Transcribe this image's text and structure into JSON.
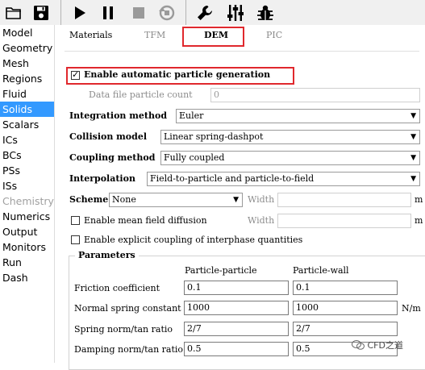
{
  "toolbar": {
    "buttons": [
      {
        "name": "open-folder-icon"
      },
      {
        "name": "save-icon"
      },
      {
        "name": "play-icon"
      },
      {
        "name": "pause-icon"
      },
      {
        "name": "stop-icon"
      },
      {
        "name": "reset-icon"
      },
      {
        "name": "wrench-icon"
      },
      {
        "name": "sliders-icon"
      },
      {
        "name": "bug-icon"
      }
    ]
  },
  "sidebar": {
    "items": [
      {
        "label": "Model"
      },
      {
        "label": "Geometry"
      },
      {
        "label": "Mesh"
      },
      {
        "label": "Regions"
      },
      {
        "label": "Fluid"
      },
      {
        "label": "Solids"
      },
      {
        "label": "Scalars"
      },
      {
        "label": "ICs"
      },
      {
        "label": "BCs"
      },
      {
        "label": "PSs"
      },
      {
        "label": "ISs"
      },
      {
        "label": "Chemistry"
      },
      {
        "label": "Numerics"
      },
      {
        "label": "Output"
      },
      {
        "label": "Monitors"
      },
      {
        "label": "Run"
      },
      {
        "label": "Dash"
      }
    ],
    "selected": "Solids",
    "disabled": "Chemistry"
  },
  "tabs": [
    "Materials",
    "TFM",
    "DEM",
    "PIC"
  ],
  "active_tab": "DEM",
  "dem": {
    "enable_auto_gen": {
      "label": "Enable automatic particle generation",
      "checked": true
    },
    "data_file_particle_count": {
      "label": "Data file particle count",
      "value": "0"
    },
    "integration_method": {
      "label": "Integration method",
      "value": "Euler"
    },
    "collision_model": {
      "label": "Collision model",
      "value": "Linear spring-dashpot"
    },
    "coupling_method": {
      "label": "Coupling method",
      "value": "Fully coupled"
    },
    "interpolation": {
      "label": "Interpolation",
      "value": "Field-to-particle and particle-to-field"
    },
    "scheme": {
      "label": "Scheme",
      "value": "None",
      "width_label": "Width",
      "unit": "m"
    },
    "mean_field_diffusion": {
      "label": "Enable mean field diffusion",
      "checked": false,
      "width_label": "Width",
      "unit": "m"
    },
    "explicit_coupling": {
      "label": "Enable explicit coupling of interphase quantities",
      "checked": false
    },
    "parameters": {
      "title": "Parameters",
      "col_pp": "Particle-particle",
      "col_pw": "Particle-wall",
      "rows": [
        {
          "label": "Friction coefficient",
          "pp": "0.1",
          "pw": "0.1",
          "unit": ""
        },
        {
          "label": "Normal spring constant",
          "pp": "1000",
          "pw": "1000",
          "unit": "N/m"
        },
        {
          "label": "Spring norm/tan ratio",
          "pp": "2/7",
          "pw": "2/7",
          "unit": ""
        },
        {
          "label": "Damping norm/tan ratio",
          "pp": "0.5",
          "pw": "0.5",
          "unit": ""
        }
      ]
    }
  },
  "watermark": "CFD之道",
  "colors": {
    "selection": "#3399ff",
    "highlight_box": "#e0282d",
    "play_green": "#000000",
    "reset_gray": "#9a9a9a"
  }
}
